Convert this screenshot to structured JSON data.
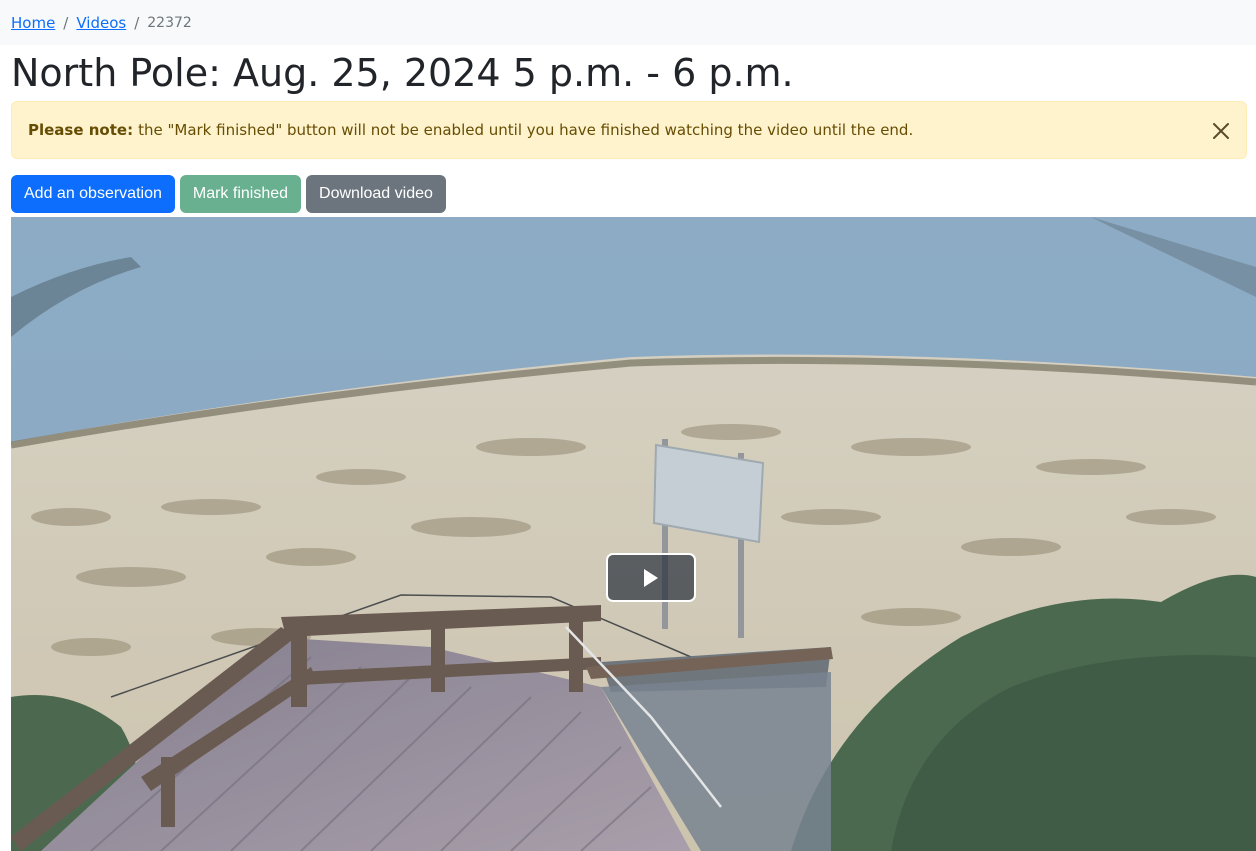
{
  "breadcrumb": {
    "home": "Home",
    "videos": "Videos",
    "current": "22372"
  },
  "page": {
    "title": "North Pole: Aug. 25, 2024 5 p.m. - 6 p.m."
  },
  "alert": {
    "strong": "Please note:",
    "message": "the \"Mark finished\" button will not be enabled until you have finished watching the video until the end."
  },
  "actions": {
    "add_observation": "Add an observation",
    "mark_finished": "Mark finished",
    "download_video": "Download video"
  },
  "video": {
    "play_icon": "play-icon"
  },
  "colors": {
    "primary": "#0d6efd",
    "success": "#198754",
    "secondary": "#6c757d",
    "alert_bg": "#fff3cd"
  }
}
